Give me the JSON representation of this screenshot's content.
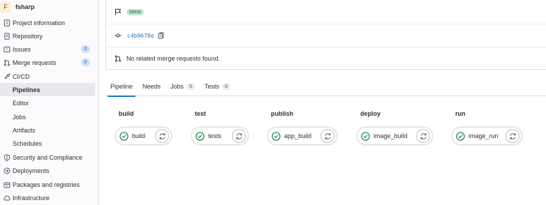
{
  "project": {
    "avatar_letter": "F",
    "name": "fsharp"
  },
  "sidebar": {
    "items": [
      {
        "label": "Project information",
        "icon": "info-icon"
      },
      {
        "label": "Repository",
        "icon": "doc-icon"
      },
      {
        "label": "Issues",
        "icon": "issues-icon",
        "count": "0"
      },
      {
        "label": "Merge requests",
        "icon": "merge-request-icon",
        "count": "0"
      },
      {
        "label": "CI/CD",
        "icon": "rocket-icon"
      },
      {
        "label": "Pipelines"
      },
      {
        "label": "Editor"
      },
      {
        "label": "Jobs"
      },
      {
        "label": "Artifacts"
      },
      {
        "label": "Schedules"
      },
      {
        "label": "Security and Compliance",
        "icon": "shield-icon"
      },
      {
        "label": "Deployments",
        "icon": "deployments-icon"
      },
      {
        "label": "Packages and registries",
        "icon": "package-icon"
      },
      {
        "label": "Infrastructure",
        "icon": "cloud-icon"
      }
    ],
    "active": "Pipelines"
  },
  "info": {
    "tag_label": "latest",
    "commit_sha": "c4b9678e",
    "merge_requests_text": "No related merge requests found."
  },
  "tabs": [
    {
      "label": "Pipeline",
      "active": true
    },
    {
      "label": "Needs"
    },
    {
      "label": "Jobs",
      "count": "5"
    },
    {
      "label": "Tests",
      "count": "0"
    }
  ],
  "stages": [
    {
      "name": "build",
      "job": "build"
    },
    {
      "name": "test",
      "job": "tests"
    },
    {
      "name": "publish",
      "job": "app_build"
    },
    {
      "name": "deploy",
      "job": "image_build"
    },
    {
      "name": "run",
      "job": "image_run"
    }
  ],
  "colors": {
    "success": "#108548",
    "link": "#1f75cb",
    "badge_bg": "#c3e6cd",
    "count_bg": "#cbe2f9"
  }
}
